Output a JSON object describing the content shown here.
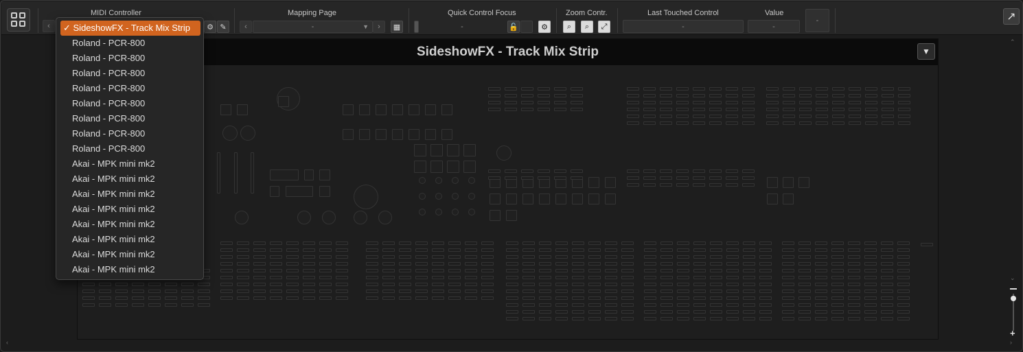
{
  "toolbar": {
    "midi_controller_label": "MIDI Controller",
    "mapping_page_label": "Mapping Page",
    "mapping_page_value": "-",
    "quick_control_focus_label": "Quick Control Focus",
    "quick_control_focus_value": "-",
    "zoom_label": "Zoom Contr.",
    "last_touched_label": "Last Touched Control",
    "last_touched_value": "-",
    "value_label": "Value",
    "value_value": "-",
    "extra_value": "-"
  },
  "panel": {
    "title": "SideshowFX - Track Mix Strip"
  },
  "dropdown": {
    "items": [
      {
        "label": "SideshowFX - Track Mix Strip",
        "selected": true
      },
      {
        "label": "Roland - PCR-800",
        "selected": false
      },
      {
        "label": "Roland - PCR-800",
        "selected": false
      },
      {
        "label": "Roland - PCR-800",
        "selected": false
      },
      {
        "label": "Roland - PCR-800",
        "selected": false
      },
      {
        "label": "Roland - PCR-800",
        "selected": false
      },
      {
        "label": "Roland - PCR-800",
        "selected": false
      },
      {
        "label": "Roland - PCR-800",
        "selected": false
      },
      {
        "label": "Roland - PCR-800",
        "selected": false
      },
      {
        "label": "Akai - MPK mini mk2",
        "selected": false
      },
      {
        "label": "Akai - MPK mini mk2",
        "selected": false
      },
      {
        "label": "Akai - MPK mini mk2",
        "selected": false
      },
      {
        "label": "Akai - MPK mini mk2",
        "selected": false
      },
      {
        "label": "Akai - MPK mini mk2",
        "selected": false
      },
      {
        "label": "Akai - MPK mini mk2",
        "selected": false
      },
      {
        "label": "Akai - MPK mini mk2",
        "selected": false
      },
      {
        "label": "Akai - MPK mini mk2",
        "selected": false
      }
    ]
  },
  "colors": {
    "accent": "#d1641f",
    "background": "#1b1b1b",
    "toolbar": "#262626"
  }
}
